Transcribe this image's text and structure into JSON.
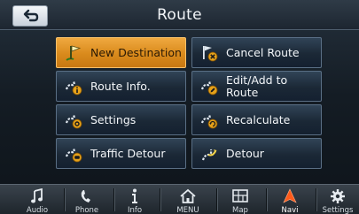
{
  "header": {
    "title": "Route"
  },
  "menu": {
    "items": [
      {
        "label": "New Destination",
        "icon": "flag-icon",
        "active": true
      },
      {
        "label": "Cancel Route",
        "icon": "cancel-route-icon",
        "active": false
      },
      {
        "label": "Route Info.",
        "icon": "route-info-icon",
        "active": false
      },
      {
        "label": "Edit/Add to Route",
        "icon": "edit-route-icon",
        "active": false
      },
      {
        "label": "Settings",
        "icon": "route-settings-icon",
        "active": false
      },
      {
        "label": "Recalculate",
        "icon": "recalculate-icon",
        "active": false
      },
      {
        "label": "Traffic Detour",
        "icon": "traffic-detour-icon",
        "active": false
      },
      {
        "label": "Detour",
        "icon": "detour-icon",
        "active": false
      }
    ]
  },
  "bottom_bar": {
    "items": [
      {
        "label": "Audio",
        "icon": "music-note-icon"
      },
      {
        "label": "Phone",
        "icon": "phone-icon"
      },
      {
        "label": "Info",
        "icon": "info-icon"
      },
      {
        "label": "MENU",
        "icon": "home-icon"
      },
      {
        "label": "Map",
        "icon": "map-icon"
      },
      {
        "label": "Navi",
        "icon": "navi-arrow-icon",
        "active": true
      },
      {
        "label": "Settings",
        "icon": "gear-icon"
      }
    ]
  },
  "colors": {
    "active_button": "#e0931f",
    "button_border": "#5a6f85",
    "navi_arrow": "#ff5a1a"
  }
}
